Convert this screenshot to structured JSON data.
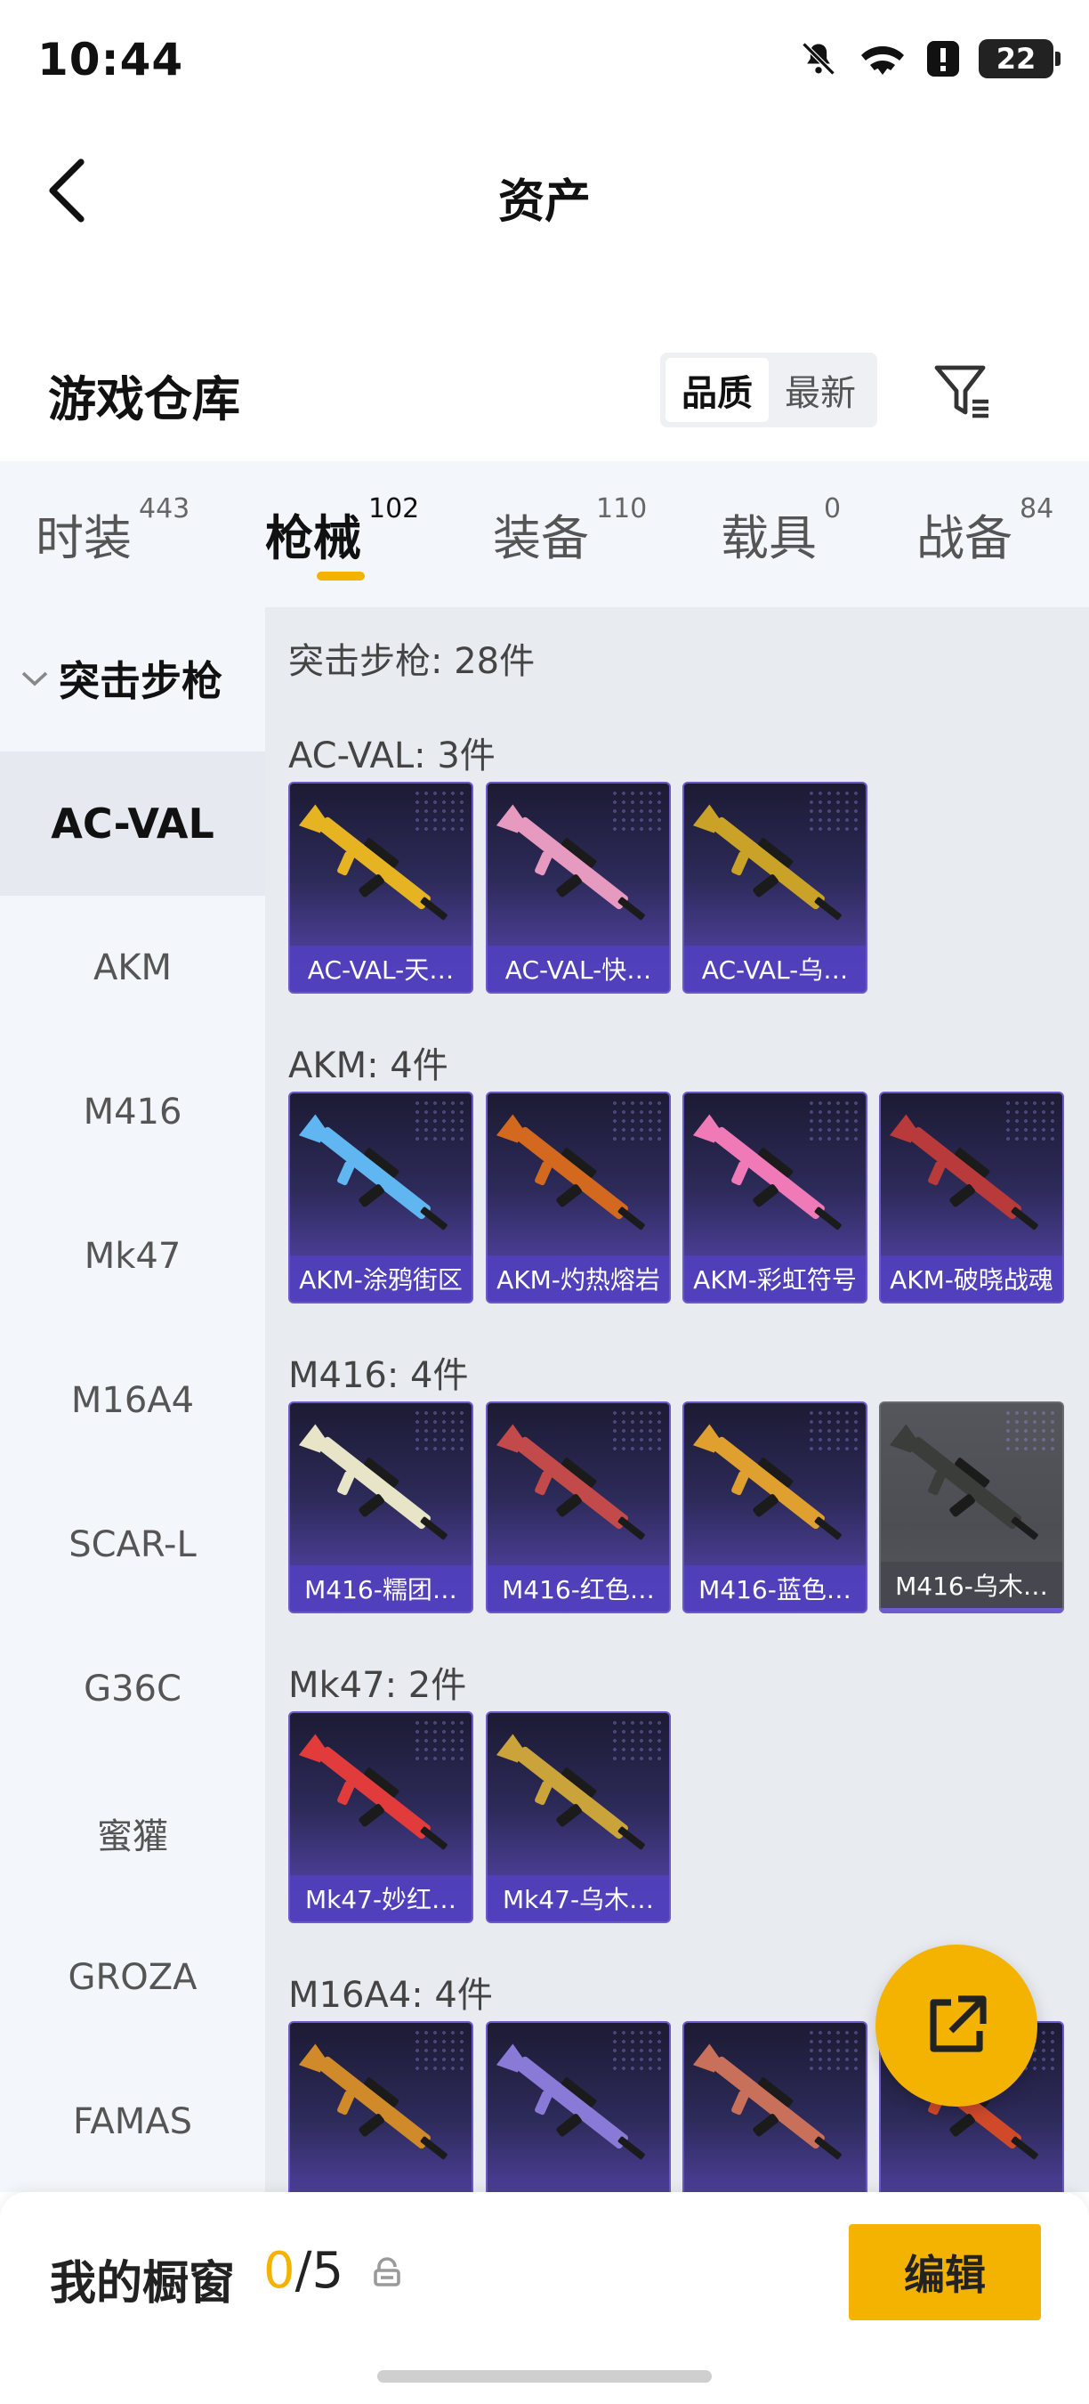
{
  "status": {
    "time": "10:44",
    "battery": "22"
  },
  "nav": {
    "title": "资产"
  },
  "section": {
    "title": "游戏仓库",
    "sort_options": [
      "品质",
      "最新"
    ]
  },
  "tabs": [
    {
      "label": "时装",
      "count": "443"
    },
    {
      "label": "枪械",
      "count": "102"
    },
    {
      "label": "装备",
      "count": "110"
    },
    {
      "label": "载具",
      "count": "0"
    },
    {
      "label": "战备",
      "count": "84"
    }
  ],
  "sidebar": {
    "group": "突击步枪",
    "items": [
      "AC-VAL",
      "AKM",
      "M416",
      "Mk47",
      "M16A4",
      "SCAR-L",
      "G36C",
      "蜜獾",
      "GROZA",
      "FAMAS"
    ]
  },
  "content": {
    "category_count": "突击步枪: 28件",
    "groups": [
      {
        "title": "AC-VAL: 3件",
        "items": [
          {
            "name": "AC-VAL-天…",
            "color": "#e6b422"
          },
          {
            "name": "AC-VAL-快…",
            "color": "#e79ac0"
          },
          {
            "name": "AC-VAL-乌…",
            "color": "#c9a227"
          }
        ]
      },
      {
        "title": "AKM: 4件",
        "items": [
          {
            "name": "AKM-涂鸦街区",
            "color": "#5fb6f0"
          },
          {
            "name": "AKM-灼热熔岩",
            "color": "#d2691e"
          },
          {
            "name": "AKM-彩虹符号",
            "color": "#f07ab8"
          },
          {
            "name": "AKM-破晓战魂",
            "color": "#b83a3a"
          }
        ]
      },
      {
        "title": "M416: 4件",
        "items": [
          {
            "name": "M416-糯团…",
            "color": "#e8e4c8"
          },
          {
            "name": "M416-红色…",
            "color": "#c24a4a"
          },
          {
            "name": "M416-蓝色…",
            "color": "#e0a030"
          },
          {
            "name": "M416-乌木…",
            "color": "#3a3d3a"
          }
        ]
      },
      {
        "title": "Mk47: 2件",
        "items": [
          {
            "name": "Mk47-妙红…",
            "color": "#e23b3b"
          },
          {
            "name": "Mk47-乌木…",
            "color": "#caa43a"
          }
        ]
      },
      {
        "title": "M16A4: 4件",
        "items": [
          {
            "name": "",
            "color": "#d08a2a"
          },
          {
            "name": "",
            "color": "#8a7ad8"
          },
          {
            "name": "",
            "color": "#c8705a"
          },
          {
            "name": "",
            "color": "#d04a2a"
          }
        ]
      }
    ]
  },
  "bottom": {
    "label": "我的橱窗",
    "used": "0",
    "total": "/5",
    "edit_label": "编辑"
  }
}
